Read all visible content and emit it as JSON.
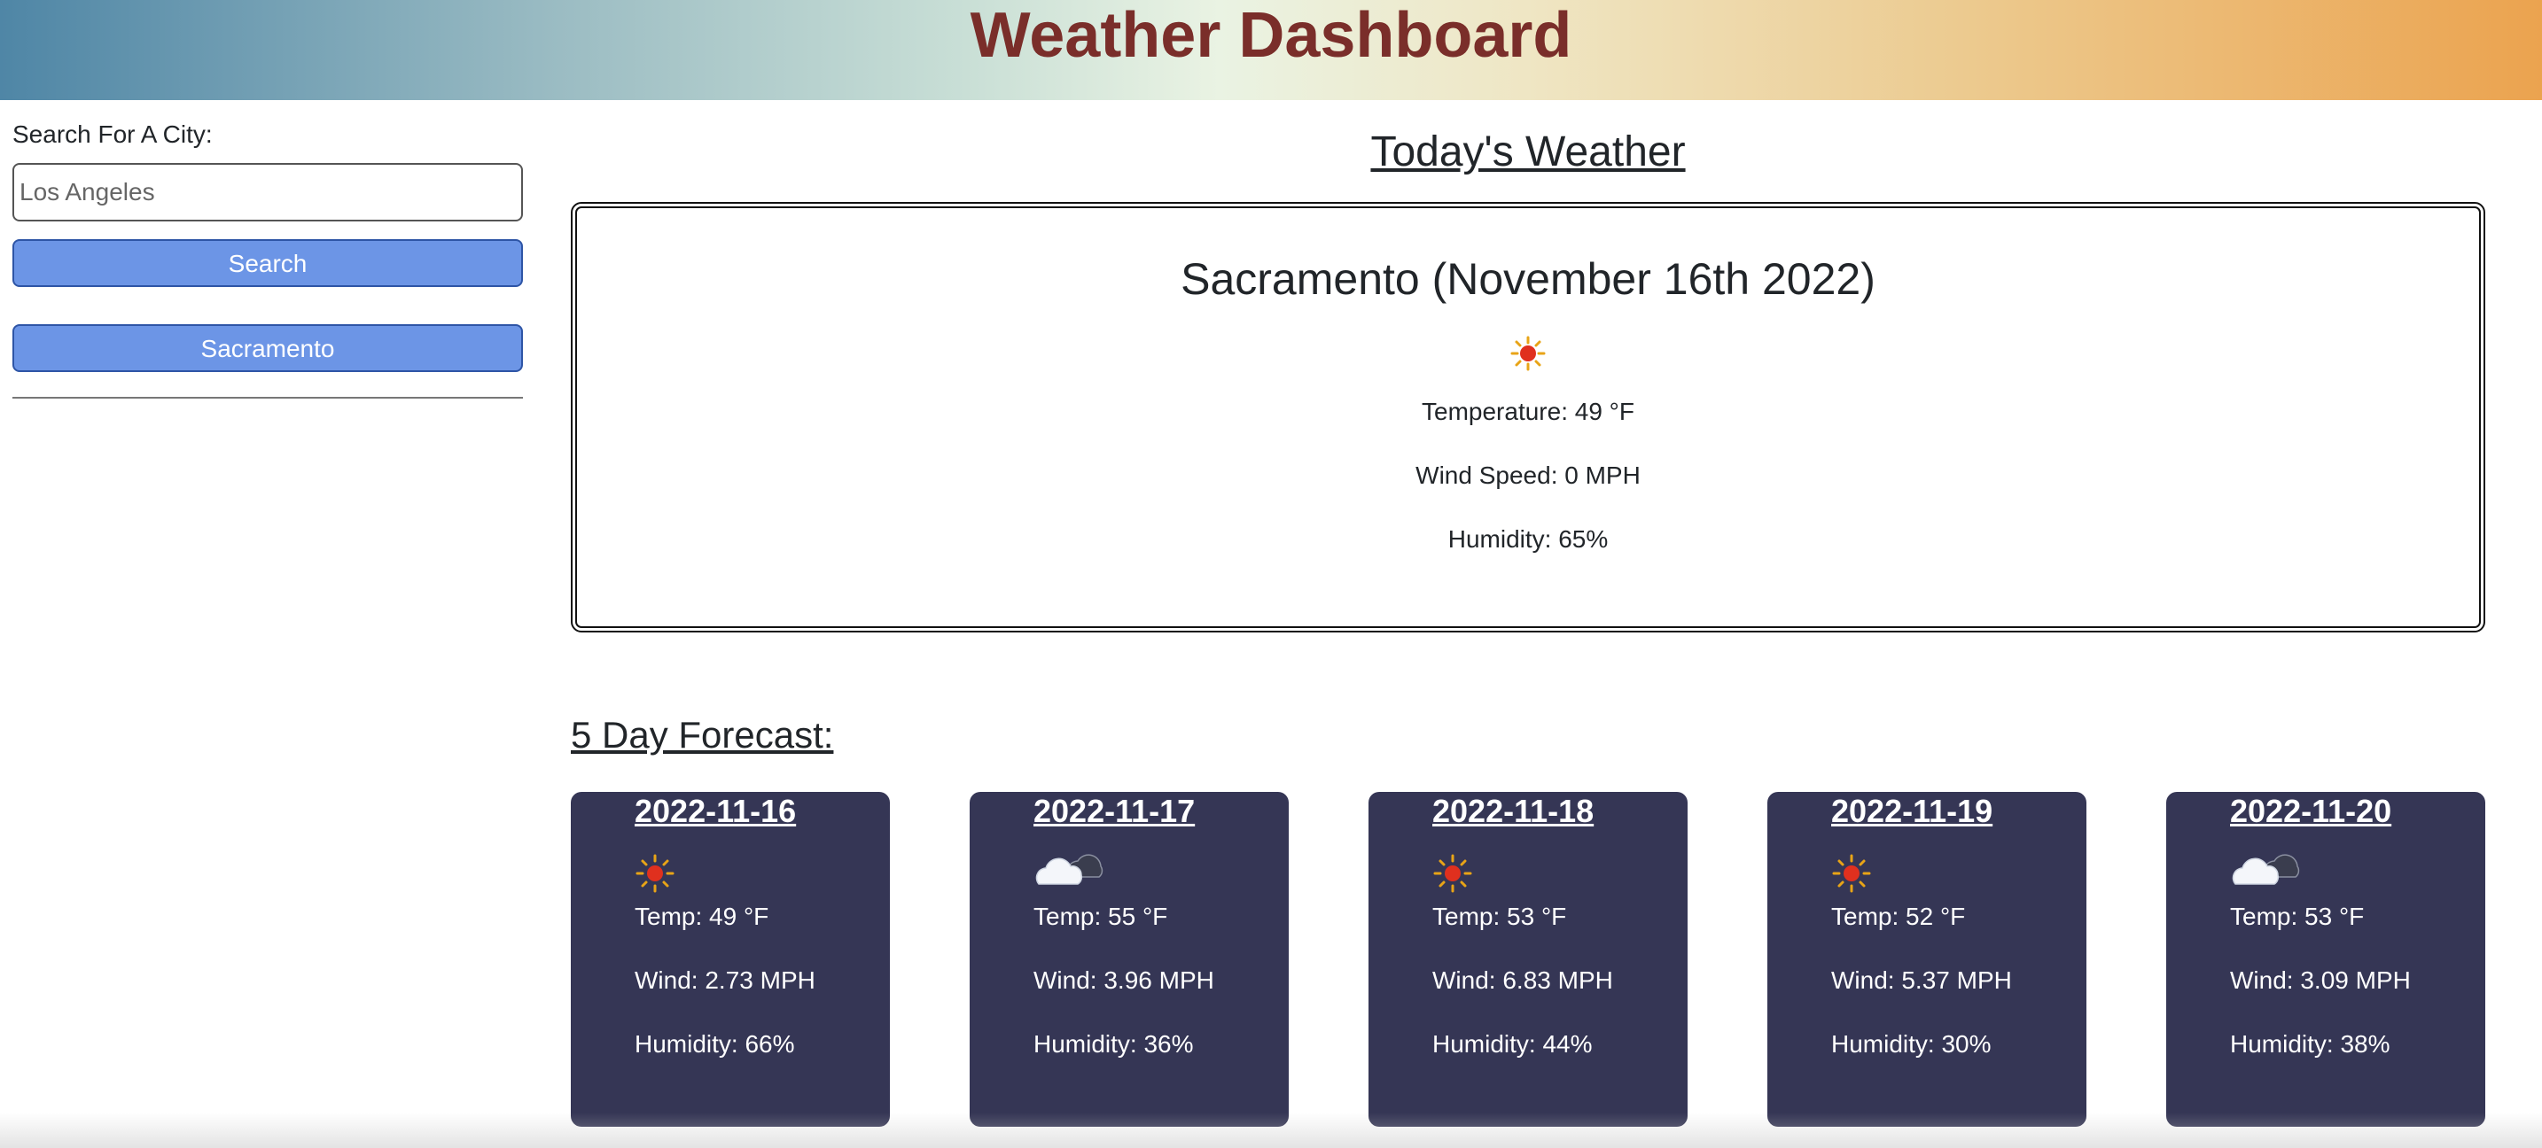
{
  "header": {
    "title": "Weather Dashboard"
  },
  "sidebar": {
    "search_label": "Search For A City:",
    "search_placeholder": "Los Angeles",
    "search_button": "Search",
    "history": [
      {
        "label": "Sacramento"
      }
    ]
  },
  "today": {
    "section_title": "Today's Weather",
    "city_heading": "Sacramento (November 16th 2022)",
    "icon": "sun-icon",
    "temperature": "Temperature: 49 °F",
    "wind": "Wind Speed: 0 MPH",
    "humidity": "Humidity: 65%"
  },
  "forecast": {
    "title": "5 Day Forecast:",
    "days": [
      {
        "date": "2022-11-16",
        "icon": "sun-icon",
        "temp": "Temp: 49 °F",
        "wind": "Wind: 2.73 MPH",
        "humidity": "Humidity: 66%"
      },
      {
        "date": "2022-11-17",
        "icon": "cloud-icon",
        "temp": "Temp: 55 °F",
        "wind": "Wind: 3.96 MPH",
        "humidity": "Humidity: 36%"
      },
      {
        "date": "2022-11-18",
        "icon": "sun-icon",
        "temp": "Temp: 53 °F",
        "wind": "Wind: 6.83 MPH",
        "humidity": "Humidity: 44%"
      },
      {
        "date": "2022-11-19",
        "icon": "sun-icon",
        "temp": "Temp: 52 °F",
        "wind": "Wind: 5.37 MPH",
        "humidity": "Humidity: 30%"
      },
      {
        "date": "2022-11-20",
        "icon": "cloud-icon",
        "temp": "Temp: 53 °F",
        "wind": "Wind: 3.09 MPH",
        "humidity": "Humidity: 38%"
      }
    ]
  },
  "colors": {
    "title": "#7a2e2a",
    "button": "#6c95e6",
    "card": "#353655"
  }
}
